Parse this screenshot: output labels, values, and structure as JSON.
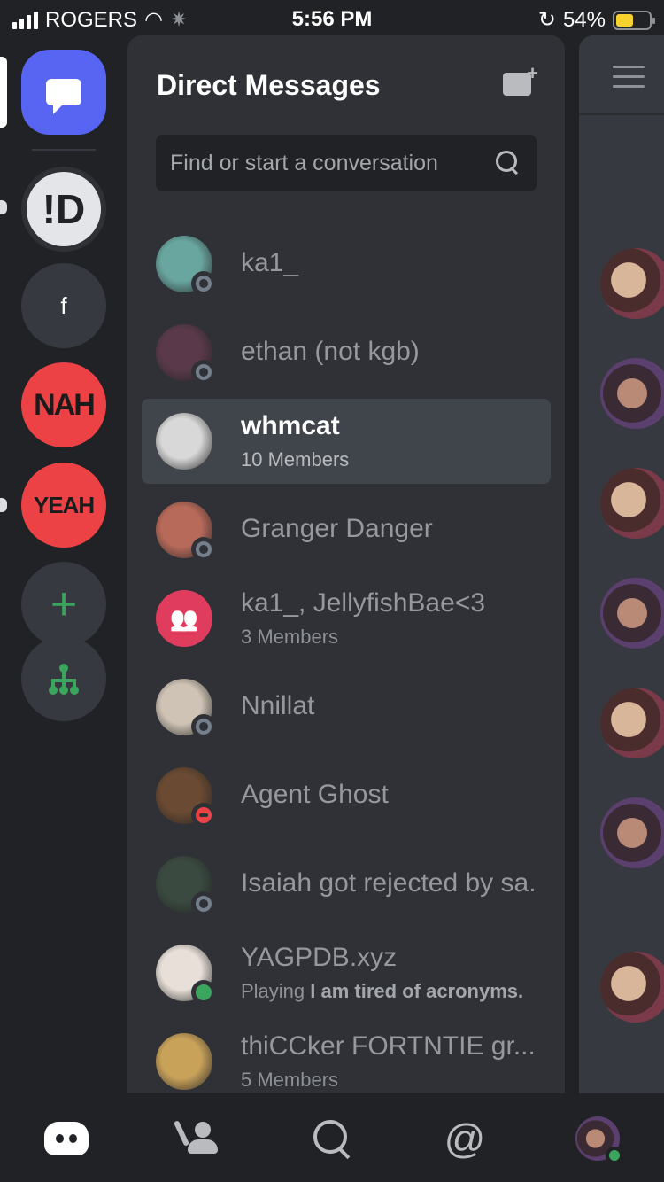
{
  "status_bar": {
    "carrier": "ROGERS",
    "time": "5:56 PM",
    "battery_percent": "54%",
    "battery_level": 0.54
  },
  "server_rail": {
    "servers": [
      {
        "icon": "direct-messages-icon",
        "selected": true
      },
      {
        "icon": "discord-server-icon",
        "unread": true
      },
      {
        "label": "f"
      },
      {
        "label": "NAH"
      },
      {
        "label": "YEAH",
        "unread": true
      },
      {
        "icon": "add-server-icon"
      },
      {
        "icon": "explore-servers-icon"
      }
    ]
  },
  "panel": {
    "title": "Direct Messages",
    "search_placeholder": "Find or start a conversation"
  },
  "dms": [
    {
      "name": "ka1_",
      "status": "offline",
      "avatar_color": "#6aa6a0"
    },
    {
      "name": "ethan (not kgb)",
      "status": "offline",
      "avatar_color": "#5a3a4a"
    },
    {
      "name": "whmcat",
      "sub": "10 Members",
      "active": true,
      "avatar_color": "#d8d8d8"
    },
    {
      "name": "Granger Danger",
      "status": "offline",
      "avatar_color": "#b86a5a"
    },
    {
      "name": "ka1_, JellyfishBae<3",
      "sub": "3 Members",
      "group": true
    },
    {
      "name": "Nnillat",
      "status": "offline",
      "avatar_color": "#cfc3b5"
    },
    {
      "name": "Agent Ghost",
      "status": "dnd",
      "avatar_color": "#6a4a32"
    },
    {
      "name": "Isaiah got rejected by sa.",
      "status": "offline",
      "avatar_color": "#3a4a40"
    },
    {
      "name": "YAGPDB.xyz",
      "sub_prefix": "Playing ",
      "sub_bold": "I am tired of acronyms.",
      "status": "online",
      "avatar_color": "#e8e0d8"
    },
    {
      "name": "thiCCker FORTNTIE gr...",
      "sub": "5 Members",
      "avatar_color": "#c9a25a"
    }
  ],
  "colors": {
    "accent": "#5865f2",
    "online": "#3ba55d",
    "dnd": "#ed4245",
    "offline": "#747f8d"
  },
  "tabbar": {
    "tabs": [
      "home-icon",
      "friends-icon",
      "search-icon",
      "mentions-icon",
      "profile-avatar"
    ]
  }
}
